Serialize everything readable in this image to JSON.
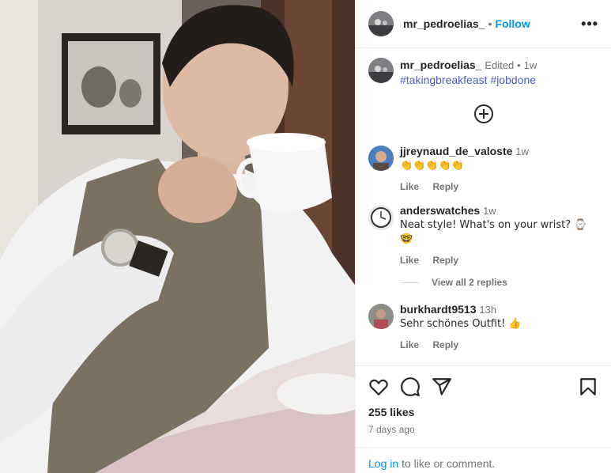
{
  "post": {
    "author": "mr_pedroelias_",
    "follow_label": "Follow",
    "dot": "•",
    "more_icon": "more-horizontal-icon"
  },
  "caption": {
    "author": "mr_pedroelias_",
    "edited": "Edited",
    "dot": "•",
    "time": "1w",
    "hashtags": "#takingbreakfeast #jobdone"
  },
  "comments": [
    {
      "user": "jjreynaud_de_valoste",
      "time": "1w",
      "text": "👏👏👏👏👏",
      "like": "Like",
      "reply": "Reply"
    },
    {
      "user": "anderswatches",
      "time": "1w",
      "text": "Neat style! What's on your wrist? ⌚",
      "text2": "🤓",
      "like": "Like",
      "reply": "Reply"
    },
    {
      "user": "burkhardt9513",
      "time": "13h",
      "text": "Sehr schönes Outfit! 👍",
      "like": "Like",
      "reply": "Reply"
    }
  ],
  "view_replies": "View all 2 replies",
  "footer": {
    "likes": "255 likes",
    "ago": "7 days ago",
    "login_link": "Log in",
    "login_rest": " to like or comment."
  },
  "colors": {
    "link": "#0095f6",
    "hashtag": "#4a5dbf",
    "muted": "#737373"
  }
}
